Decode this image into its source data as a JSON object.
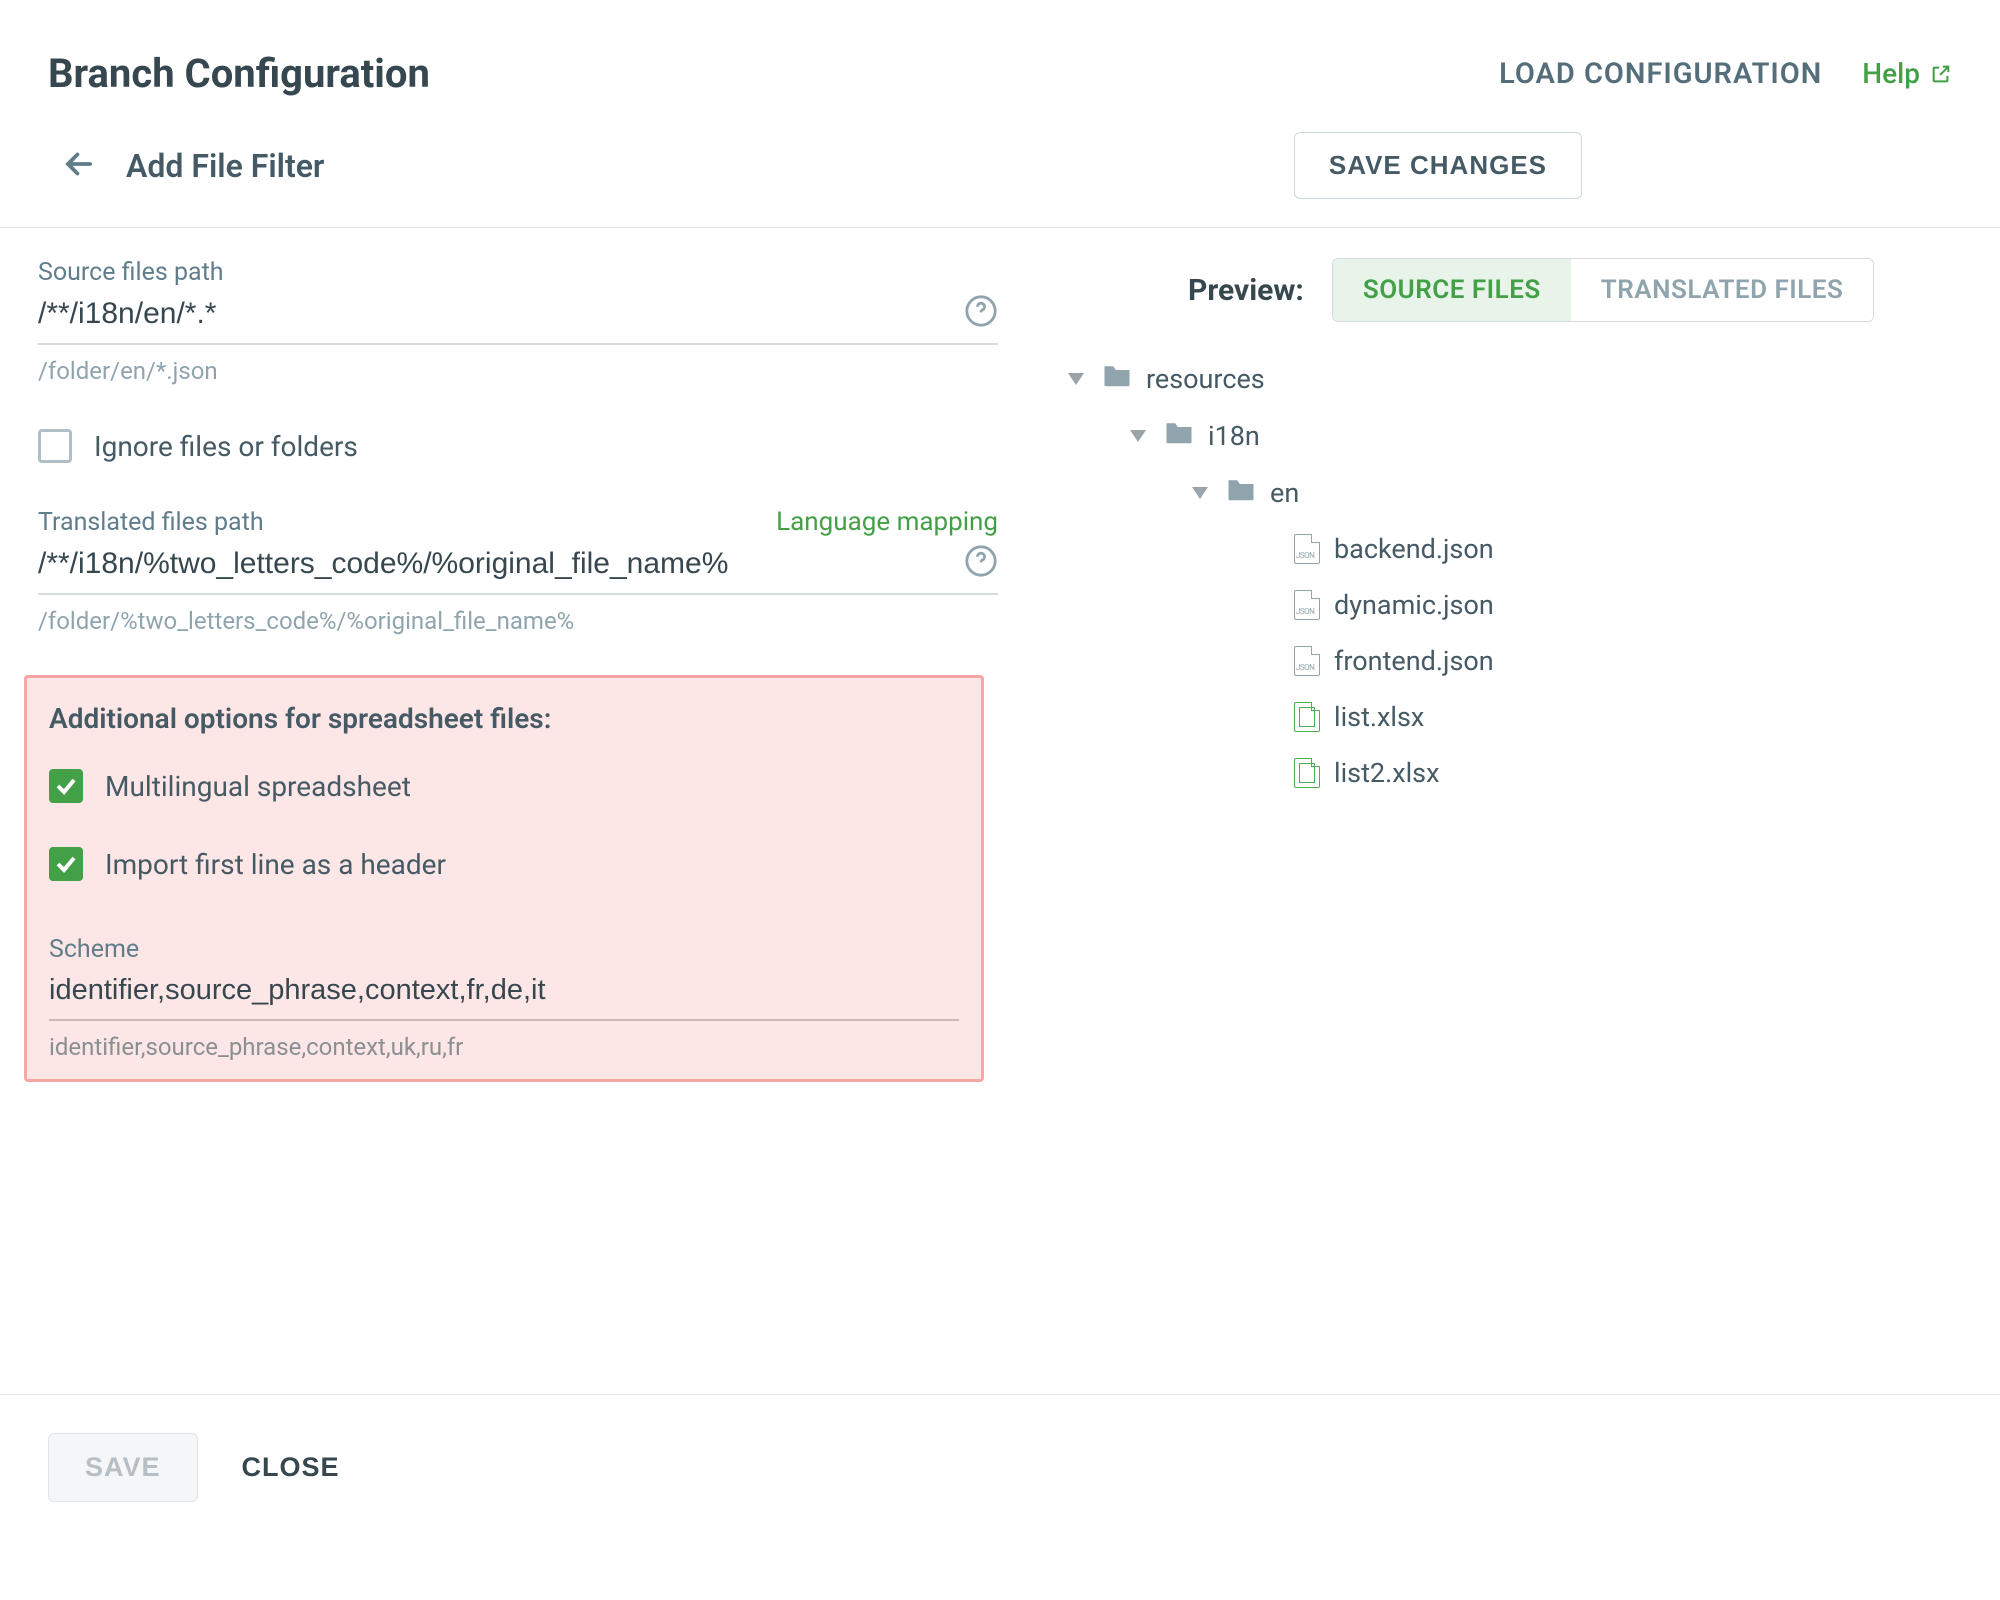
{
  "header": {
    "title": "Branch Configuration",
    "load_config": "LOAD CONFIGURATION",
    "help": "Help"
  },
  "subheader": {
    "title": "Add File Filter",
    "save_changes": "SAVE CHANGES"
  },
  "source": {
    "label": "Source files path",
    "value": "/**/i18n/en/*.*",
    "hint": "/folder/en/*.json"
  },
  "ignore": {
    "label": "Ignore files or folders",
    "checked": false
  },
  "translated": {
    "label": "Translated files path",
    "lang_map": "Language mapping",
    "value": "/**/i18n/%two_letters_code%/%original_file_name%",
    "hint": "/folder/%two_letters_code%/%original_file_name%"
  },
  "spreadsheet": {
    "title": "Additional options for spreadsheet files:",
    "multilingual": {
      "label": "Multilingual spreadsheet",
      "checked": true
    },
    "first_line": {
      "label": "Import first line as a header",
      "checked": true
    },
    "scheme_label": "Scheme",
    "scheme_value": "identifier,source_phrase,context,fr,de,it",
    "scheme_hint": "identifier,source_phrase,context,uk,ru,fr"
  },
  "preview": {
    "label": "Preview:",
    "tab_source": "SOURCE FILES",
    "tab_translated": "TRANSLATED FILES",
    "tree": {
      "n1": "resources",
      "n2": "i18n",
      "n3": "en",
      "files": [
        "backend.json",
        "dynamic.json",
        "frontend.json",
        "list.xlsx",
        "list2.xlsx"
      ]
    }
  },
  "footer": {
    "save": "SAVE",
    "close": "CLOSE"
  }
}
